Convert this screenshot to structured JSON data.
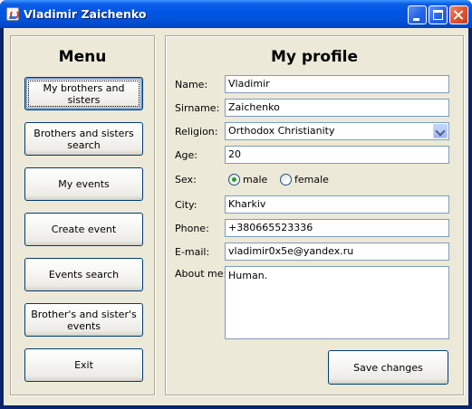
{
  "window": {
    "title": "Vladimir Zaichenko"
  },
  "menu": {
    "title": "Menu",
    "buttons": [
      {
        "label": "My brothers and sisters"
      },
      {
        "label": "Brothers and sisters search"
      },
      {
        "label": "My events"
      },
      {
        "label": "Create event"
      },
      {
        "label": "Events search"
      },
      {
        "label": "Brother's and sister's events"
      },
      {
        "label": "Exit"
      }
    ]
  },
  "profile": {
    "title": "My profile",
    "name": {
      "label": "Name:",
      "value": "Vladimir"
    },
    "surname": {
      "label": "Sirname:",
      "value": "Zaichenko"
    },
    "religion": {
      "label": "Religion:",
      "value": "Orthodox Christianity"
    },
    "age": {
      "label": "Age:",
      "value": "20"
    },
    "sex": {
      "label": "Sex:",
      "options": [
        "male",
        "female"
      ],
      "selected": "male"
    },
    "city": {
      "label": "City:",
      "value": "Kharkiv"
    },
    "phone": {
      "label": "Phone:",
      "value": "+380665523336"
    },
    "email": {
      "label": "E-mail:",
      "value": "vladimir0x5e@yandex.ru"
    },
    "about": {
      "label": "About me:",
      "value": "Human."
    },
    "save_label": "Save changes"
  },
  "icons": {
    "app": "java-cup-icon",
    "minimize": "minimize-icon",
    "maximize": "maximize-icon",
    "close": "close-icon"
  },
  "colors": {
    "titlebar": "#0054e3",
    "client_bg": "#ece9d8",
    "button_border": "#003c74",
    "field_border": "#7f9db9",
    "radio_dot": "#21a121"
  }
}
